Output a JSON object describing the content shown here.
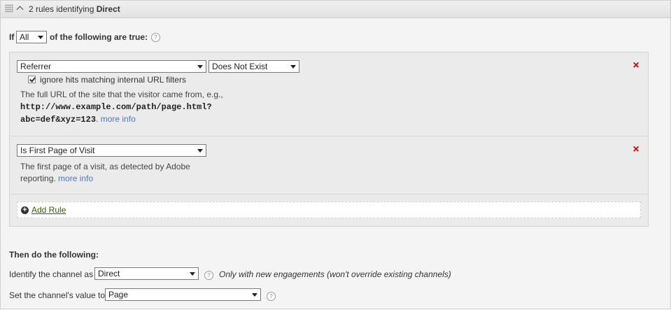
{
  "header": {
    "prefix": "2 rules identifying",
    "channel": "Direct"
  },
  "condition": {
    "if_label": "If",
    "match_value": "All",
    "suffix": "of the following are true:"
  },
  "rules": [
    {
      "field": "Referrer",
      "operator": "Does Not Exist",
      "checkbox_label": "ignore hits matching internal URL filters",
      "checkbox_checked": true,
      "desc_text": "The full URL of the site that the visitor came from, e.g.,",
      "desc_code_line1": "http://www.example.com/path/page.html?",
      "desc_code_line2": "abc=def&xyz=123",
      "desc_end": ".",
      "more_info": "more info"
    },
    {
      "field": "Is First Page of Visit",
      "desc_line1": "The first page of a visit, as detected by Adobe",
      "desc_line2": "reporting.",
      "more_info": "more info"
    }
  ],
  "add_rule_label": "Add Rule",
  "then": {
    "title": "Then do the following:",
    "identify_label": "Identify the channel as",
    "identify_value": "Direct",
    "identify_note": "Only with new engagements (won't override existing channels)",
    "value_label": "Set the channel's value to",
    "value_value": "Page"
  },
  "icons": {
    "grip": "drag-handle-icon",
    "collapse": "chevron-up-icon",
    "help": "help-icon",
    "remove": "close-icon",
    "add": "plus-circle-icon"
  },
  "colors": {
    "remove": "#d40000",
    "link": "#4a79c7",
    "add_rule": "#3a5a10"
  }
}
